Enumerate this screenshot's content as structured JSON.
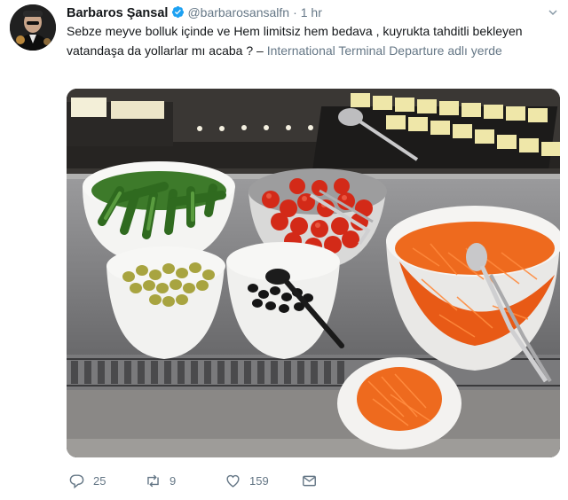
{
  "tweet": {
    "author_name": "Barbaros Şansal",
    "author_handle": "@barbarosansalfn",
    "separator": "·",
    "time_ago": "1 hr",
    "text": "Sebze meyve bolluk içinde ve Hem limitsiz hem bedava , kuyrukta tahditli bekleyen vatandaşa da  yollarlar mı acaba ? – ",
    "location": "International Terminal Departure adlı yerde",
    "verified": true
  },
  "media": {
    "description_icon": "photo-of-salad-bar",
    "items": [
      "cheese-tray",
      "cucumbers-bowl",
      "cherry-tomatoes-bowl",
      "olives-bowl",
      "black-olives-bowl",
      "grated-carrots-bowl",
      "small-carrot-plate",
      "serving-tongs"
    ]
  },
  "actions": {
    "reply_count": "25",
    "retweet_count": "9",
    "like_count": "159"
  },
  "colors": {
    "text": "#14171a",
    "secondary": "#657786",
    "verified_blue": "#1da1f2"
  }
}
